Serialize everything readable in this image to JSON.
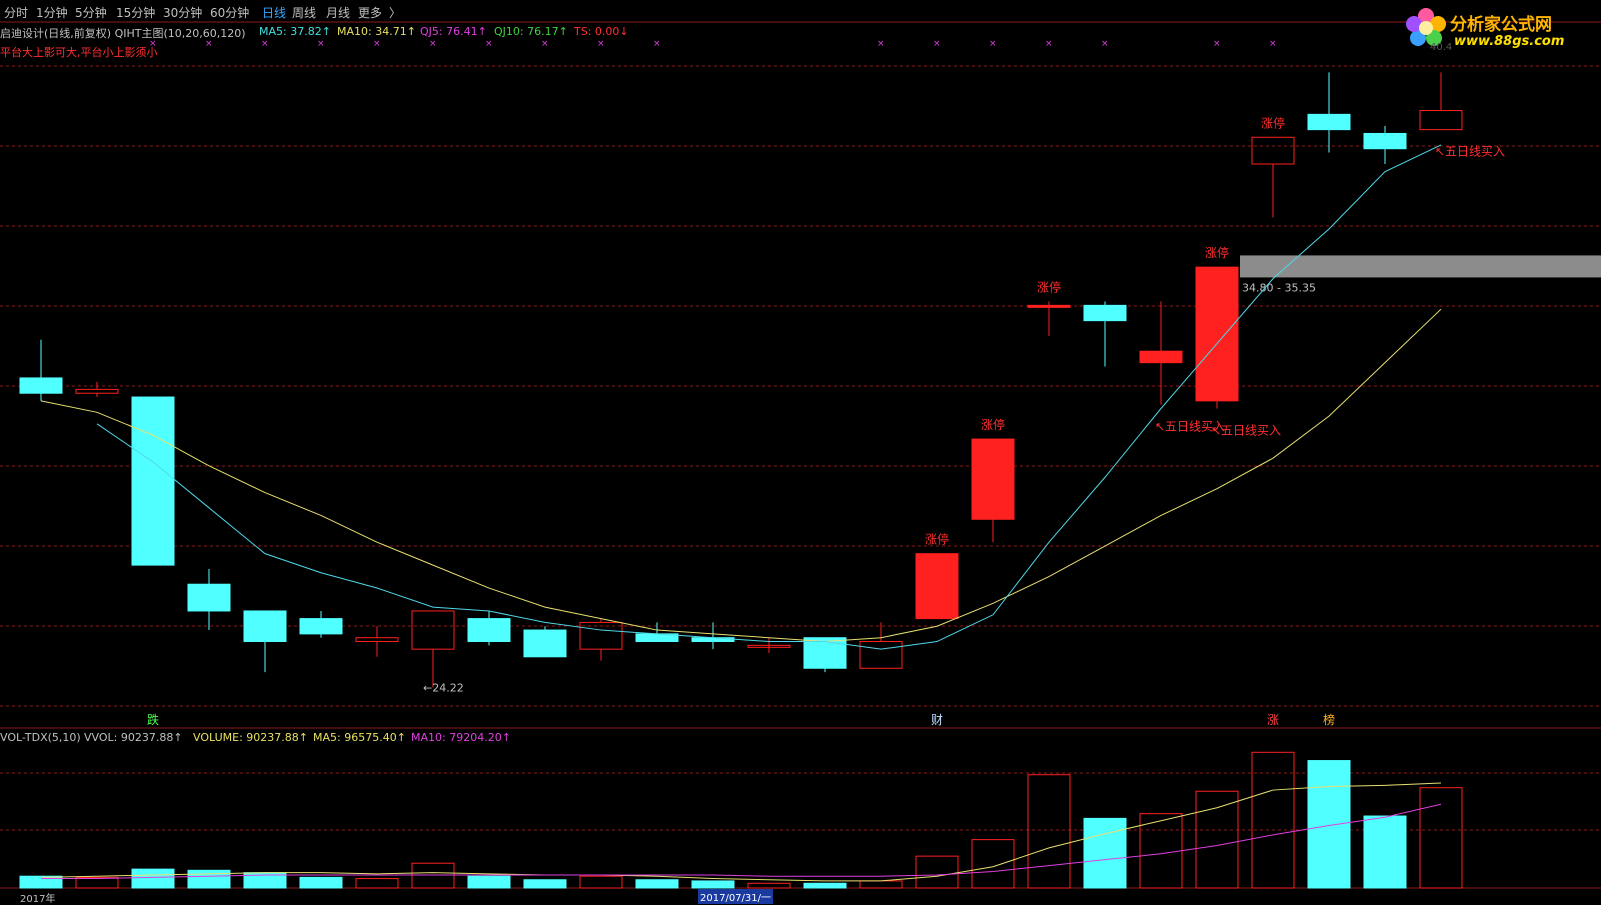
{
  "tabs": [
    {
      "label": "分时",
      "active": false
    },
    {
      "label": "1分钟",
      "active": false
    },
    {
      "label": "5分钟",
      "active": false
    },
    {
      "label": "15分钟",
      "active": false
    },
    {
      "label": "30分钟",
      "active": false
    },
    {
      "label": "60分钟",
      "active": false
    },
    {
      "label": "日线",
      "active": true
    },
    {
      "label": "周线",
      "active": false
    },
    {
      "label": "月线",
      "active": false
    },
    {
      "label": "更多",
      "active": false
    }
  ],
  "more_arrow": "〉",
  "logo": {
    "title": "分析家公式网",
    "url": "www.88gs.com",
    "watermark": "40.4"
  },
  "main_panel": {
    "title": "启迪设计(日线,前复权) QIHT主图(10,20,60,120)",
    "indicators": [
      {
        "label": "MA5: 37.82",
        "arrow": "↑",
        "color": "#40e0e0"
      },
      {
        "label": "MA10: 34.71",
        "arrow": "↑",
        "color": "#e8e060"
      },
      {
        "label": "QJ5: 76.41",
        "arrow": "↑",
        "color": "#e040e0"
      },
      {
        "label": "QJ10: 76.17",
        "arrow": "↑",
        "color": "#40d040"
      },
      {
        "label": "TS: 0.00",
        "arrow": "↓",
        "color": "#ff3030"
      }
    ],
    "subtitle": "平台大上影可大,平台小上影须小",
    "low_label": "←24.22",
    "zone_label": "34.80 - 35.35"
  },
  "volume_panel": {
    "name": "VOL-TDX(5,10)",
    "indicators": [
      {
        "label": "VVOL: 90237.88",
        "arrow": "↑",
        "color": "#c0c0c0"
      },
      {
        "label": "VOLUME: 90237.88",
        "arrow": "↑",
        "color": "#e8e060"
      },
      {
        "label": "MA5: 96575.40",
        "arrow": "↑",
        "color": "#e8e060"
      },
      {
        "label": "MA10: 79204.20",
        "arrow": "↑",
        "color": "#e040e0"
      }
    ]
  },
  "axis": {
    "year_label": "2017年",
    "cursor_date": "2017/07/31/一"
  },
  "colors": {
    "up": "#ff2020",
    "down": "#50ffff",
    "ma5": "#50d8e8",
    "ma10": "#e8e070",
    "vma10": "#e040e0",
    "grid": "#8b1a1a"
  },
  "chart_data": {
    "type": "candlestick",
    "candles": [
      {
        "o": 32.3,
        "h": 33.3,
        "l": 31.7,
        "c": 31.9
      },
      {
        "o": 31.9,
        "h": 32.2,
        "l": 31.8,
        "c": 32.0
      },
      {
        "o": 31.8,
        "h": 31.8,
        "l": 27.4,
        "c": 27.4
      },
      {
        "o": 26.9,
        "h": 27.3,
        "l": 25.7,
        "c": 26.2
      },
      {
        "o": 26.2,
        "h": 26.2,
        "l": 24.6,
        "c": 25.4
      },
      {
        "o": 26.0,
        "h": 26.2,
        "l": 25.5,
        "c": 25.6
      },
      {
        "o": 25.4,
        "h": 25.8,
        "l": 25.0,
        "c": 25.5
      },
      {
        "o": 25.2,
        "h": 26.2,
        "l": 24.2,
        "c": 26.2
      },
      {
        "o": 26.0,
        "h": 26.2,
        "l": 25.3,
        "c": 25.4
      },
      {
        "o": 25.7,
        "h": 25.8,
        "l": 25.0,
        "c": 25.0
      },
      {
        "o": 25.2,
        "h": 26.0,
        "l": 24.9,
        "c": 25.9
      },
      {
        "o": 25.6,
        "h": 25.9,
        "l": 25.4,
        "c": 25.4
      },
      {
        "o": 25.5,
        "h": 25.9,
        "l": 25.2,
        "c": 25.4
      },
      {
        "o": 25.3,
        "h": 25.5,
        "l": 25.1,
        "c": 25.3
      },
      {
        "o": 25.5,
        "h": 25.5,
        "l": 24.6,
        "c": 24.7
      },
      {
        "o": 24.7,
        "h": 25.9,
        "l": 24.7,
        "c": 25.4
      },
      {
        "o": 26.0,
        "h": 27.7,
        "l": 26.0,
        "c": 27.7
      },
      {
        "o": 28.6,
        "h": 30.7,
        "l": 28.0,
        "c": 30.7
      },
      {
        "o": 34.2,
        "h": 34.3,
        "l": 33.4,
        "c": 34.2
      },
      {
        "o": 34.2,
        "h": 34.3,
        "l": 32.6,
        "c": 33.8
      },
      {
        "o": 32.7,
        "h": 34.3,
        "l": 31.6,
        "c": 33.0
      },
      {
        "o": 31.7,
        "h": 35.2,
        "l": 31.5,
        "c": 35.2
      },
      {
        "o": 37.9,
        "h": 38.6,
        "l": 36.5,
        "c": 38.6
      },
      {
        "o": 39.2,
        "h": 40.3,
        "l": 38.2,
        "c": 38.8
      },
      {
        "o": 38.7,
        "h": 38.9,
        "l": 37.9,
        "c": 38.3
      },
      {
        "o": 38.8,
        "h": 40.3,
        "l": 38.8,
        "c": 39.3
      }
    ],
    "ma5": [
      null,
      31.1,
      30.1,
      28.9,
      27.7,
      27.2,
      26.8,
      26.3,
      26.2,
      25.9,
      25.7,
      25.6,
      25.5,
      25.4,
      25.4,
      25.2,
      25.4,
      26.1,
      28.0,
      29.7,
      31.5,
      33.2,
      34.9,
      36.2,
      37.7,
      38.4
    ],
    "ma10": [
      31.7,
      31.4,
      30.8,
      30.0,
      29.3,
      28.7,
      28.0,
      27.4,
      26.8,
      26.3,
      26.0,
      25.7,
      25.6,
      25.5,
      25.4,
      25.5,
      25.8,
      26.4,
      27.1,
      27.9,
      28.7,
      29.4,
      30.2,
      31.3,
      32.7,
      34.1
    ],
    "labels": [
      {
        "index": 16,
        "text": "涨停"
      },
      {
        "index": 17,
        "text": "涨停"
      },
      {
        "index": 18,
        "text": "涨停"
      },
      {
        "index": 21,
        "text": "涨停"
      },
      {
        "index": 22,
        "text": "涨停"
      }
    ],
    "buy_signals": [
      {
        "index": 20,
        "text": "↖五日线买入"
      },
      {
        "index": 21,
        "text": "↖五日线买入"
      },
      {
        "index": 25,
        "text": "↖五日线买入"
      }
    ],
    "bottom_markers": [
      {
        "index": 2,
        "text": "跌",
        "color": "#50ff50"
      },
      {
        "index": 16,
        "text": "财",
        "color": "#c0e0ff"
      },
      {
        "index": 22,
        "text": "涨",
        "color": "#ff4040"
      },
      {
        "index": 23,
        "text": "榜",
        "color": "#ffb020"
      }
    ],
    "top_markers": [
      2,
      3,
      4,
      5,
      6,
      7,
      8,
      9,
      10,
      11,
      15,
      16,
      17,
      18,
      19,
      21,
      22
    ],
    "zone": {
      "from_index": 21,
      "low": 34.8,
      "high": 35.35
    },
    "volume": [
      1.0,
      0.9,
      1.6,
      1.5,
      1.3,
      0.9,
      0.8,
      2.1,
      1.0,
      0.7,
      1.0,
      0.7,
      0.6,
      0.4,
      0.4,
      0.6,
      2.7,
      4.1,
      9.6,
      5.9,
      6.3,
      8.2,
      11.5,
      10.8,
      6.1,
      8.5
    ],
    "volume_ma5": [
      0.9,
      1.0,
      1.1,
      1.2,
      1.3,
      1.3,
      1.2,
      1.3,
      1.2,
      1.1,
      1.1,
      1.0,
      0.8,
      0.7,
      0.6,
      0.6,
      1.0,
      1.8,
      3.4,
      4.6,
      5.7,
      6.8,
      8.3,
      8.6,
      8.7,
      8.9
    ],
    "volume_ma10": [
      0.8,
      0.8,
      0.9,
      1.0,
      1.1,
      1.1,
      1.1,
      1.1,
      1.1,
      1.1,
      1.1,
      1.1,
      1.1,
      1.0,
      1.0,
      1.0,
      1.1,
      1.4,
      1.9,
      2.4,
      2.9,
      3.6,
      4.5,
      5.3,
      6.0,
      7.1
    ]
  }
}
